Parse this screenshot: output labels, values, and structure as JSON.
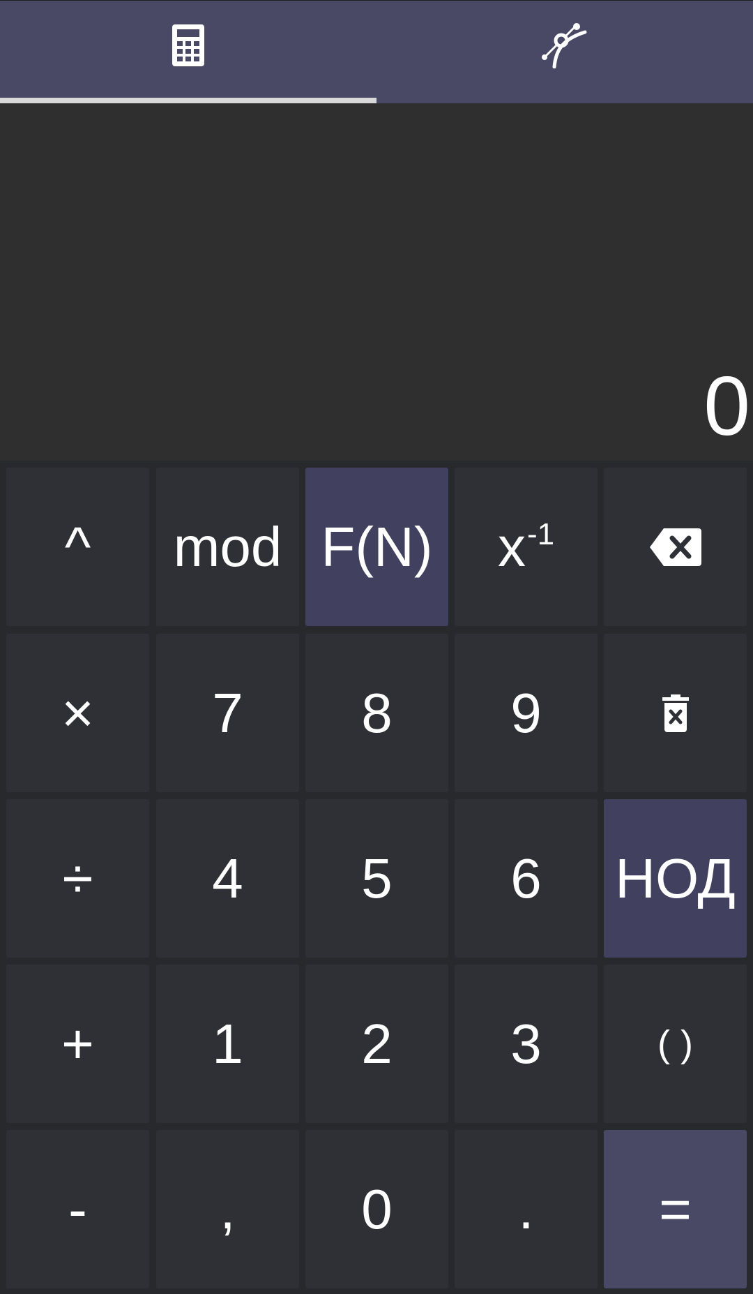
{
  "tabs": [
    {
      "name": "calculator",
      "icon": "calculator-icon",
      "selected": true
    },
    {
      "name": "graph",
      "icon": "curve-graph-icon",
      "selected": false
    }
  ],
  "display": {
    "value": "0"
  },
  "keys": {
    "power": "^",
    "mod": "mod",
    "fn": "F(N)",
    "inverse_base": "x",
    "inverse_exp": "-1",
    "backspace": "backspace-icon",
    "multiply": "×",
    "seven": "7",
    "eight": "8",
    "nine": "9",
    "clear": "trash-icon",
    "divide": "÷",
    "four": "4",
    "five": "5",
    "six": "6",
    "gcd": "НОД",
    "plus": "+",
    "one": "1",
    "two": "2",
    "three": "3",
    "parens": "( )",
    "minus": "-",
    "comma": ",",
    "zero": "0",
    "dot": ".",
    "equals": "="
  },
  "colors": {
    "tabbar": "#4a4965",
    "accent_key": "#41405f",
    "key": "#2f3035",
    "display_bg": "#2f2f2f",
    "indicator": "#d9d9d9"
  }
}
